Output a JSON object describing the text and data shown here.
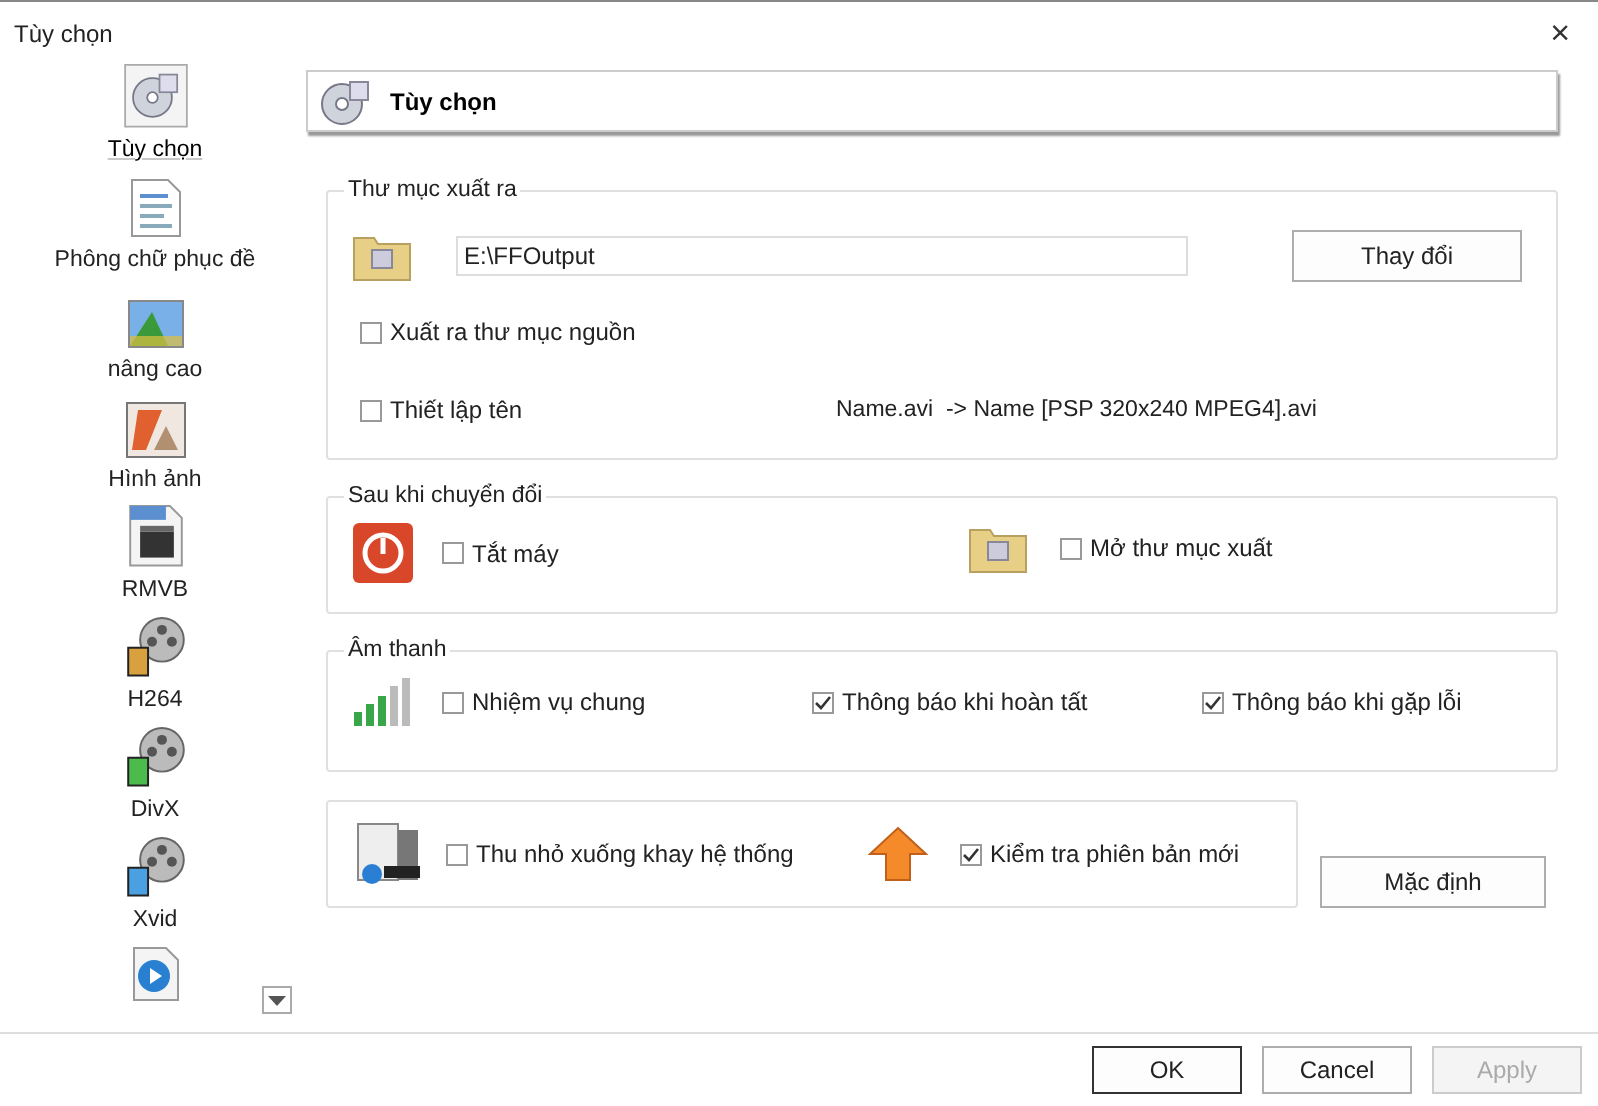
{
  "window": {
    "title": "Tùy chọn",
    "close": "×"
  },
  "sidebar": {
    "items": [
      {
        "label": "Tùy chọn",
        "selected": true
      },
      {
        "label": "Phông chữ phục đề",
        "selected": false
      },
      {
        "label": "nâng cao",
        "selected": false
      },
      {
        "label": "Hình ảnh",
        "selected": false
      },
      {
        "label": "RMVB",
        "selected": false
      },
      {
        "label": "H264",
        "selected": false
      },
      {
        "label": "DivX",
        "selected": false
      },
      {
        "label": "Xvid",
        "selected": false
      }
    ]
  },
  "header": {
    "title": "Tùy chọn"
  },
  "output_folder": {
    "title": "Thư mục xuất ra",
    "path": "E:\\FFOutput",
    "change_button": "Thay đổi",
    "options": [
      {
        "label": "Xuất ra thư mục nguồn",
        "checked": false
      },
      {
        "label": "Thiết lập tên",
        "checked": false
      }
    ],
    "name_example": "Name.avi  -> Name [PSP 320x240 MPEG4].avi"
  },
  "after_convert": {
    "title": "Sau khi chuyển đổi",
    "options": [
      {
        "label": "Tắt máy",
        "checked": false
      },
      {
        "label": "Mở thư mục xuất",
        "checked": false
      }
    ]
  },
  "sound": {
    "title": "Âm thanh",
    "options": [
      {
        "label": "Nhiệm vụ chung",
        "checked": false
      },
      {
        "label": "Thông báo khi hoàn tất",
        "checked": true
      },
      {
        "label": "Thông báo khi gặp lỗi",
        "checked": true
      }
    ]
  },
  "misc": {
    "options": [
      {
        "label": "Thu nhỏ xuống khay hệ thống",
        "checked": false
      },
      {
        "label": "Kiểm tra phiên bản mới",
        "checked": true
      }
    ]
  },
  "default_button": "Mặc định",
  "buttons": [
    {
      "label": "OK",
      "disabled": false
    },
    {
      "label": "Cancel",
      "disabled": false
    },
    {
      "label": "Apply",
      "disabled": true
    }
  ]
}
